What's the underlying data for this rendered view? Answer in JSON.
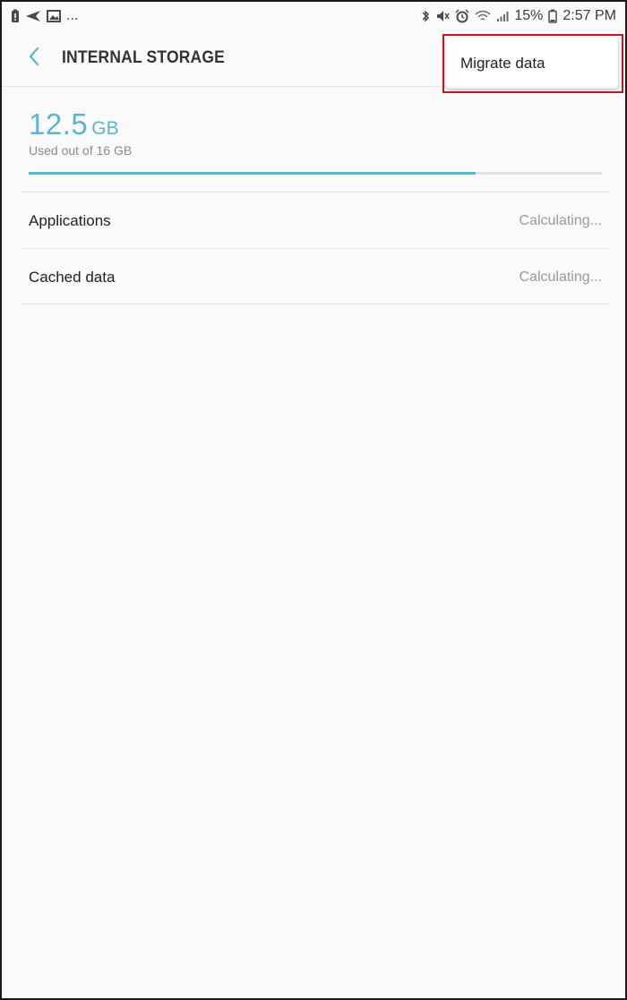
{
  "status_bar": {
    "battery_percent": "15%",
    "time": "2:57 PM",
    "left_overflow": "..."
  },
  "header": {
    "title": "INTERNAL STORAGE"
  },
  "overflow_menu": {
    "items": [
      {
        "label": "Migrate data"
      }
    ]
  },
  "storage": {
    "used_value": "12.5",
    "used_unit": "GB",
    "caption": "Used out of 16 GB",
    "used_fraction": 0.78
  },
  "rows": [
    {
      "label": "Applications",
      "value": "Calculating..."
    },
    {
      "label": "Cached data",
      "value": "Calculating..."
    }
  ],
  "colors": {
    "accent": "#5cb4cf",
    "highlight": "#c8141c"
  },
  "icons": {
    "status_left": [
      "battery-alert-icon",
      "send-icon",
      "image-icon"
    ],
    "status_right": [
      "bluetooth-icon",
      "mute-icon",
      "alarm-icon",
      "wifi-icon",
      "signal-icon",
      "battery-icon"
    ],
    "header": "back-chevron-icon"
  }
}
